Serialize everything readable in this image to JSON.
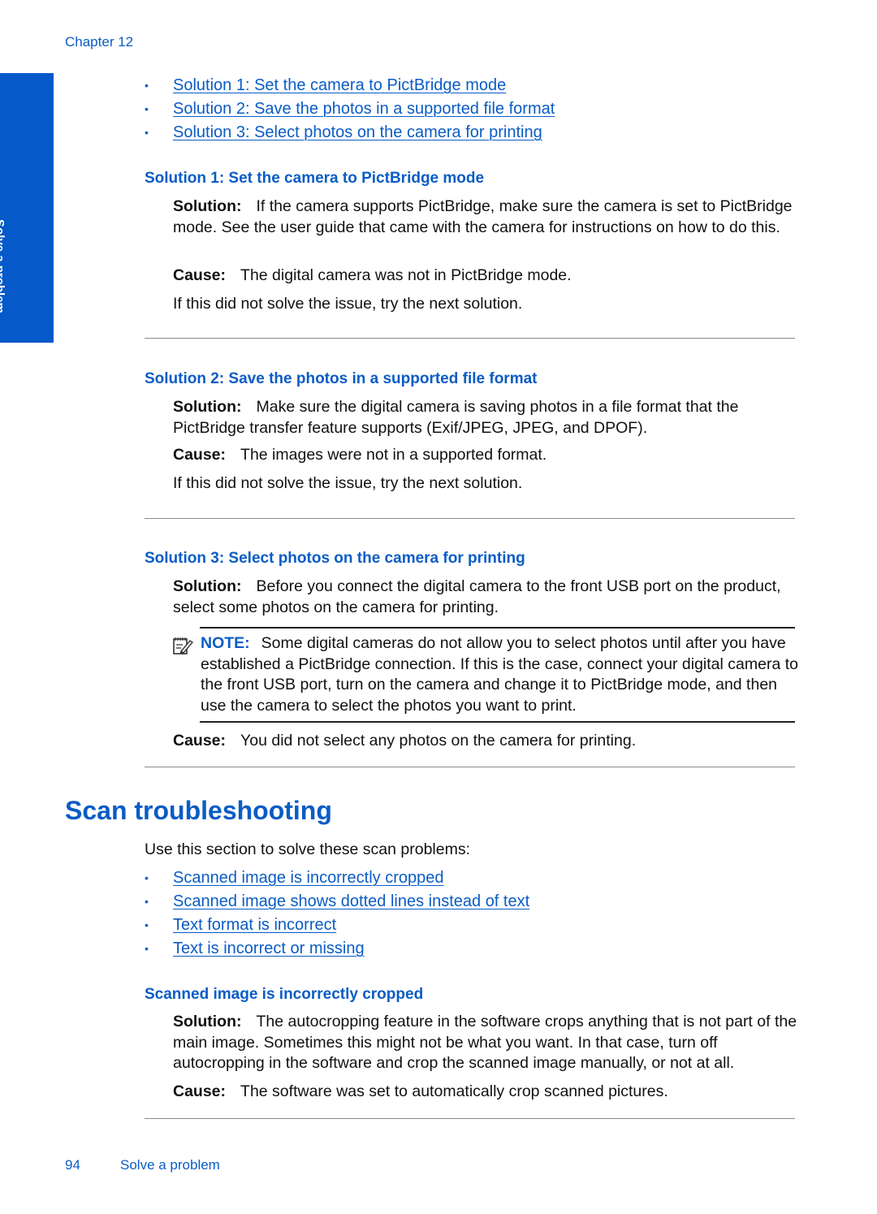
{
  "header": {
    "chapter": "Chapter 12"
  },
  "side_tab": {
    "label": "Solve a problem"
  },
  "colors": {
    "accent": "#0a5cc5",
    "side_tab_bg": "#0559c9",
    "rule": "#8a8a8a"
  },
  "top_links": [
    "Solution 1: Set the camera to PictBridge mode",
    "Solution 2: Save the photos in a supported file format",
    "Solution 3: Select photos on the camera for printing"
  ],
  "solutions": [
    {
      "heading": "Solution 1: Set the camera to PictBridge mode",
      "solution_label": "Solution:",
      "solution_text": "If the camera supports PictBridge, make sure the camera is set to PictBridge mode. See the user guide that came with the camera for instructions on how to do this.",
      "cause_label": "Cause:",
      "cause_text": "The digital camera was not in PictBridge mode.",
      "next": "If this did not solve the issue, try the next solution."
    },
    {
      "heading": "Solution 2: Save the photos in a supported file format",
      "solution_label": "Solution:",
      "solution_text": "Make sure the digital camera is saving photos in a file format that the PictBridge transfer feature supports (Exif/JPEG, JPEG, and DPOF).",
      "cause_label": "Cause:",
      "cause_text": "The images were not in a supported format.",
      "next": "If this did not solve the issue, try the next solution."
    },
    {
      "heading": "Solution 3: Select photos on the camera for printing",
      "solution_label": "Solution:",
      "solution_text": "Before you connect the digital camera to the front USB port on the product, select some photos on the camera for printing.",
      "note_label": "NOTE:",
      "note_text": "Some digital cameras do not allow you to select photos until after you have established a PictBridge connection. If this is the case, connect your digital camera to the front USB port, turn on the camera and change it to PictBridge mode, and then use the camera to select the photos you want to print.",
      "cause_label": "Cause:",
      "cause_text": "You did not select any photos on the camera for printing."
    }
  ],
  "scan": {
    "title": "Scan troubleshooting",
    "intro": "Use this section to solve these scan problems:",
    "links": [
      "Scanned image is incorrectly cropped",
      "Scanned image shows dotted lines instead of text",
      "Text format is incorrect",
      "Text is incorrect or missing"
    ],
    "section": {
      "heading": "Scanned image is incorrectly cropped",
      "solution_label": "Solution:",
      "solution_text": "The autocropping feature in the software crops anything that is not part of the main image. Sometimes this might not be what you want. In that case, turn off autocropping in the software and crop the scanned image manually, or not at all.",
      "cause_label": "Cause:",
      "cause_text": "The software was set to automatically crop scanned pictures."
    }
  },
  "footer": {
    "page_number": "94",
    "section": "Solve a problem"
  },
  "bullet_glyph": "•"
}
